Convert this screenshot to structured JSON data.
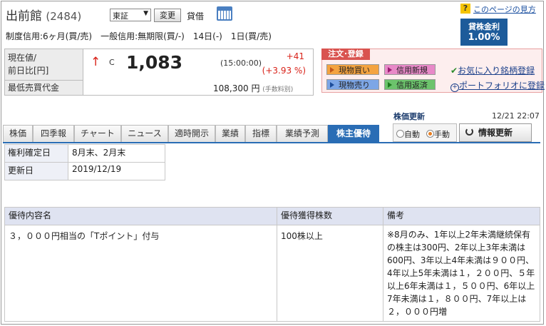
{
  "header": {
    "company_name": "出前館",
    "code": "(2484)",
    "market_select": "東証",
    "change_button": "変更",
    "taishaku": "貸借",
    "help_icon": "?",
    "help_link": "このページの見方",
    "rate_label": "貸株金利",
    "rate_value": "1.00%"
  },
  "margin_info": "制度信用:6ヶ月(買/売)　一般信用:無期限(買/-)　14日(-)　1日(買/売)",
  "price": {
    "label_current": "現在値/",
    "label_change": "前日比[円]",
    "arrow": "↑",
    "flag": "C",
    "value": "1,083",
    "time": "(15:00:00)",
    "change": "+41",
    "change_pct": "(+3.93 %)",
    "label_min": "最低売買代金",
    "min_value": "108,300",
    "min_unit": "円",
    "min_note": "(手数料別)"
  },
  "order": {
    "heading": "注文･登録",
    "buy": "現物買い",
    "sell": "現物売り",
    "margin_new": "信用新規",
    "margin_close": "信用返済",
    "favorite": "お気に入り銘柄登録",
    "portfolio": "ポートフォリオに登録"
  },
  "update": {
    "title": "株価更新",
    "time": "12/21 22:07",
    "auto": "自動",
    "manual": "手動",
    "refresh": "情報更新"
  },
  "tabs": [
    "株価",
    "四季報",
    "チャート",
    "ニュース",
    "適時開示",
    "業績",
    "指標",
    "業績予測",
    "株主優待"
  ],
  "record": {
    "rows": [
      {
        "label": "権利確定日",
        "value": "8月末、2月末"
      },
      {
        "label": "更新日",
        "value": "2019/12/19"
      }
    ]
  },
  "benefit": {
    "headers": [
      "優待内容名",
      "優待獲得株数",
      "備考"
    ],
    "rows": [
      {
        "name": "３，０００円相当の「Tポイント」付与",
        "shares": "100株以上",
        "note": "※8月のみ、1年以上2年未満継続保有の株主は300円、2年以上3年未満は600円、3年以上4年未満は９００円、4年以上5年未満は１，２００円、５年以上6年未満は１，５００円、6年以上7年未満は１，８００円、7年以上は２，０００円増"
      }
    ]
  },
  "colors": {
    "accent": "#2a6db5",
    "price_up": "#d9231a",
    "rate_bg": "#1d5b9a",
    "order_bg": "#fdeeee",
    "buy": "#f4a340",
    "sell": "#7da6e6",
    "margin_new": "#e889c8",
    "margin_close": "#6cc36c"
  }
}
